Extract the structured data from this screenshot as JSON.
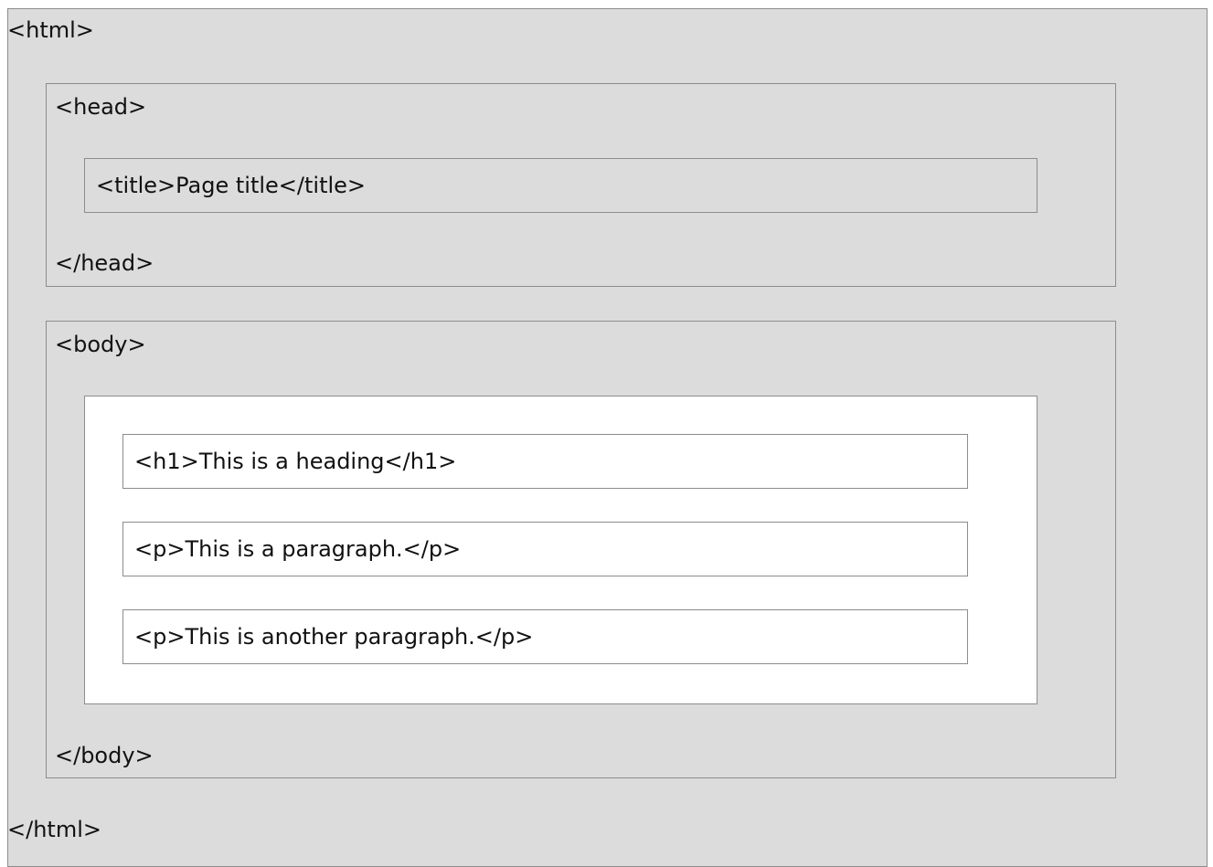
{
  "diagram": {
    "html": {
      "open_tag": "<html>",
      "close_tag": "</html>"
    },
    "head": {
      "open_tag": "<head>",
      "close_tag": "</head>",
      "title_element": "<title>Page title</title>"
    },
    "body": {
      "open_tag": "<body>",
      "close_tag": "</body>",
      "elements": [
        "<h1>This is a heading</h1>",
        "<p>This is a paragraph.</p>",
        "<p>This is another paragraph.</p>"
      ]
    }
  },
  "colors": {
    "outer_background": "#dcdcdc",
    "content_background": "#ffffff",
    "border": "#8c8c8c"
  }
}
